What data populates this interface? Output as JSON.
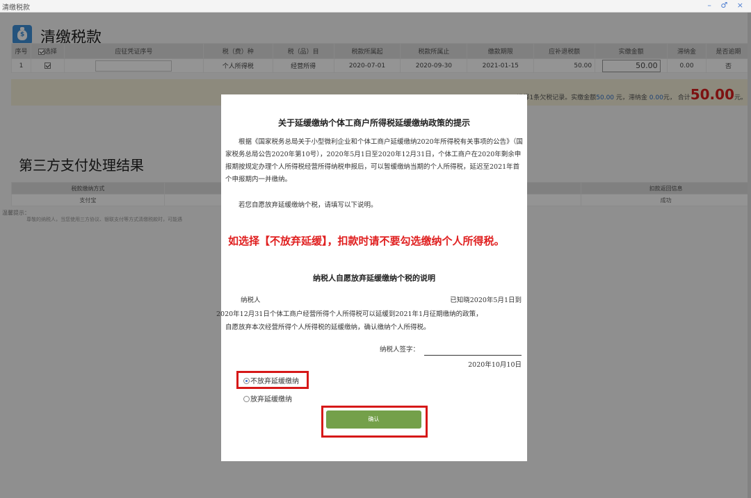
{
  "window": {
    "title": "清缴税款",
    "controls": "– ♂ ×"
  },
  "page": {
    "title": "清缴税款"
  },
  "table": {
    "headers": [
      "序号",
      "选择",
      "应征凭证序号",
      "税（费）种",
      "税（品）目",
      "税款所属起",
      "税款所属止",
      "缴款期限",
      "应补退税额",
      "实缴金额",
      "滞纳金",
      "是否逾期"
    ],
    "row": {
      "index": "1",
      "tax_type": "个人所得税",
      "item": "经营所得",
      "period_start": "2020-07-01",
      "period_end": "2020-09-30",
      "deadline": "2021-01-15",
      "payable": "50.00",
      "paid": "50.00",
      "late_fee": "0.00",
      "overdue": "否"
    }
  },
  "summary": {
    "prefix": "选择1条欠税记录。实缴金额",
    "paid": "50.00",
    "mid": " 元，滞纳金 ",
    "late": "0.00",
    "suffix": "元，",
    "total_label": "合计",
    "total": "50.00",
    "unit": "元。"
  },
  "payment": {
    "title": "第三方支付处理结果",
    "headers": [
      "税款缴纳方式",
      "",
      "",
      "扣款返回信息"
    ],
    "row": [
      "支付宝",
      "",
      "",
      "成功"
    ],
    "hint_label": "温馨提示：",
    "hint_text": "尊敬的纳税人，当您使用三方协议、银联支付等方式清缴税款时，可能遇"
  },
  "modal": {
    "title": "关于延缓缴纳个体工商户所得税延缓缴纳政策的提示",
    "para1": "根据《国家税务总局关于小型微利企业和个体工商户延缓缴纳2020年所得税有关事项的公告》（国家税务总局公告2020年第10号），2020年5月1日至2020年12月31日，个体工商户在2020年剩余申报期按规定办理个人所得税经营所得纳税申报后，可以暂缓缴纳当期的个人所得税，延迟至2021年首个申报期内一并缴纳。",
    "para2": "若您自愿放弃延缓缴纳个税，请填写以下说明。",
    "warning": "如选择【不放弃延缓】，扣款时请不要勾选缴纳个人所得税。",
    "sub_title": "纳税人自愿放弃延缓缴纳个税的说明",
    "decl_a": "纳税人",
    "decl_b": "已知晓2020年5月1日到",
    "decl_c": "2020年12月31日个体工商户经营所得个人所得税可以延缓到2021年1月征期缴纳的政策，",
    "decl_d": "自愿放弃本次经营所得个人所得税的延缓缴纳，确认缴纳个人所得税。",
    "sign_label": "纳税人签字：",
    "date": "2020年10月10日",
    "option1": "不放弃延缓缴纳",
    "option2": "放弃延缓缴纳",
    "confirm": "确认"
  },
  "colors": {
    "accent_blue": "#3f8fd8",
    "warning_red": "#e02020",
    "highlight_red": "#d61818",
    "confirm_green": "#74a04a"
  }
}
